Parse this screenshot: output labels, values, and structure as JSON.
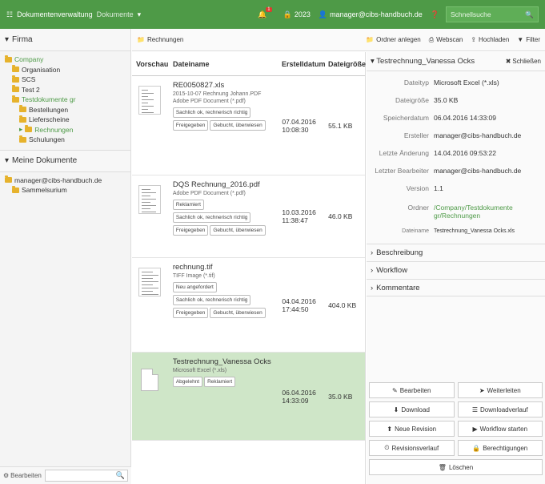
{
  "topbar": {
    "app_title": "Dokumentenverwaltung",
    "section": "Dokumente",
    "notif_count": "1",
    "year_label": "2023",
    "user": "manager@cibs-handbuch.de",
    "search_placeholder": "Schnellsuche"
  },
  "sidebar": {
    "firms_label": "Firma",
    "tree": [
      {
        "label": "Company",
        "indent": 0,
        "color": "green"
      },
      {
        "label": "Organisation",
        "indent": 1,
        "color": ""
      },
      {
        "label": "SCS",
        "indent": 1,
        "color": ""
      },
      {
        "label": "Test 2",
        "indent": 1,
        "color": ""
      },
      {
        "label": "Testdokumente gr",
        "indent": 1,
        "color": "green"
      },
      {
        "label": "Bestellungen",
        "indent": 2,
        "color": ""
      },
      {
        "label": "Lieferscheine",
        "indent": 2,
        "color": ""
      },
      {
        "label": "Rechnungen",
        "indent": 2,
        "color": "green"
      },
      {
        "label": "Schulungen",
        "indent": 2,
        "color": ""
      }
    ],
    "my_docs_label": "Meine Dokumente",
    "my_tree": [
      {
        "label": "manager@cibs-handbuch.de",
        "indent": 0
      },
      {
        "label": "Sammelsurium",
        "indent": 1
      }
    ],
    "edit_label": "Bearbeiten"
  },
  "toolbar": {
    "crumb": "Rechnungen",
    "new_folder": "Ordner anlegen",
    "webscan": "Webscan",
    "upload": "Hochladen",
    "filter": "Filter"
  },
  "list": {
    "headers": {
      "preview": "Vorschau",
      "name": "Dateiname",
      "date": "Erstelldatum",
      "size": "Dateigröße"
    },
    "rows": [
      {
        "name": "RE0050827.xls",
        "sub1": "2015-10-07 Rechnung Johann.PDF",
        "sub2": "Adobe PDF Document (*.pdf)",
        "tags": [
          "Sachlich ok, rechnerisch richtig",
          "Freigegeben",
          "Gebucht, überwiesen"
        ],
        "date": "07.04.2016 10:08:30",
        "size": "55.1 KB"
      },
      {
        "name": "DQS Rechnung_2016.pdf",
        "sub1": "Adobe PDF Document (*.pdf)",
        "sub2": "",
        "tags": [
          "Reklamiert",
          "Sachlich ok, rechnerisch richtig",
          "Freigegeben",
          "Gebucht, überwiesen"
        ],
        "date": "10.03.2016 11:38:47",
        "size": "46.0 KB"
      },
      {
        "name": "rechnung.tif",
        "sub1": "TIFF Image (*.tif)",
        "sub2": "",
        "tags": [
          "Neu angefordert",
          "Sachlich ok, rechnerisch richtig",
          "Freigegeben",
          "Gebucht, überwiesen"
        ],
        "date": "04.04.2016 17:44:50",
        "size": "404.0 KB"
      },
      {
        "name": "Testrechnung_Vanessa Ocks",
        "sub1": "Microsoft Excel (*.xls)",
        "sub2": "",
        "tags": [
          "Abgelehnt",
          "Reklamiert"
        ],
        "date": "06.04.2016 14:33:09",
        "size": "35.0 KB"
      }
    ]
  },
  "detail": {
    "title": "Testrechnung_Vanessa Ocks",
    "close_label": "Schließen",
    "props": [
      {
        "k": "Dateityp",
        "v": "Microsoft Excel (*.xls)"
      },
      {
        "k": "Dateigröße",
        "v": "35.0 KB"
      },
      {
        "k": "Speicherdatum",
        "v": "06.04.2016 14:33:09"
      },
      {
        "k": "Ersteller",
        "v": "manager@cibs-handbuch.de"
      },
      {
        "k": "Letzte Änderung",
        "v": "14.04.2016 09:53:22"
      },
      {
        "k": "Letzter Bearbeiter",
        "v": "manager@cibs-handbuch.de"
      },
      {
        "k": "Version",
        "v": "1.1"
      }
    ],
    "folder_k": "Ordner",
    "folder_v": "/Company/Testdokumente gr/Rechnungen",
    "filename_k": "Dateiname",
    "filename_v": "Testrechnung_Vanessa Ocks.xls",
    "sections": [
      "Beschreibung",
      "Workflow",
      "Kommentare"
    ],
    "actions": {
      "edit": "Bearbeiten",
      "forward": "Weiterleiten",
      "download": "Download",
      "history": "Downloadverlauf",
      "new_revision": "Neue Revision",
      "start_workflow": "Workflow starten",
      "revisions": "Revisionsverlauf",
      "permissions": "Berechtigungen",
      "delete": "Löschen"
    }
  }
}
